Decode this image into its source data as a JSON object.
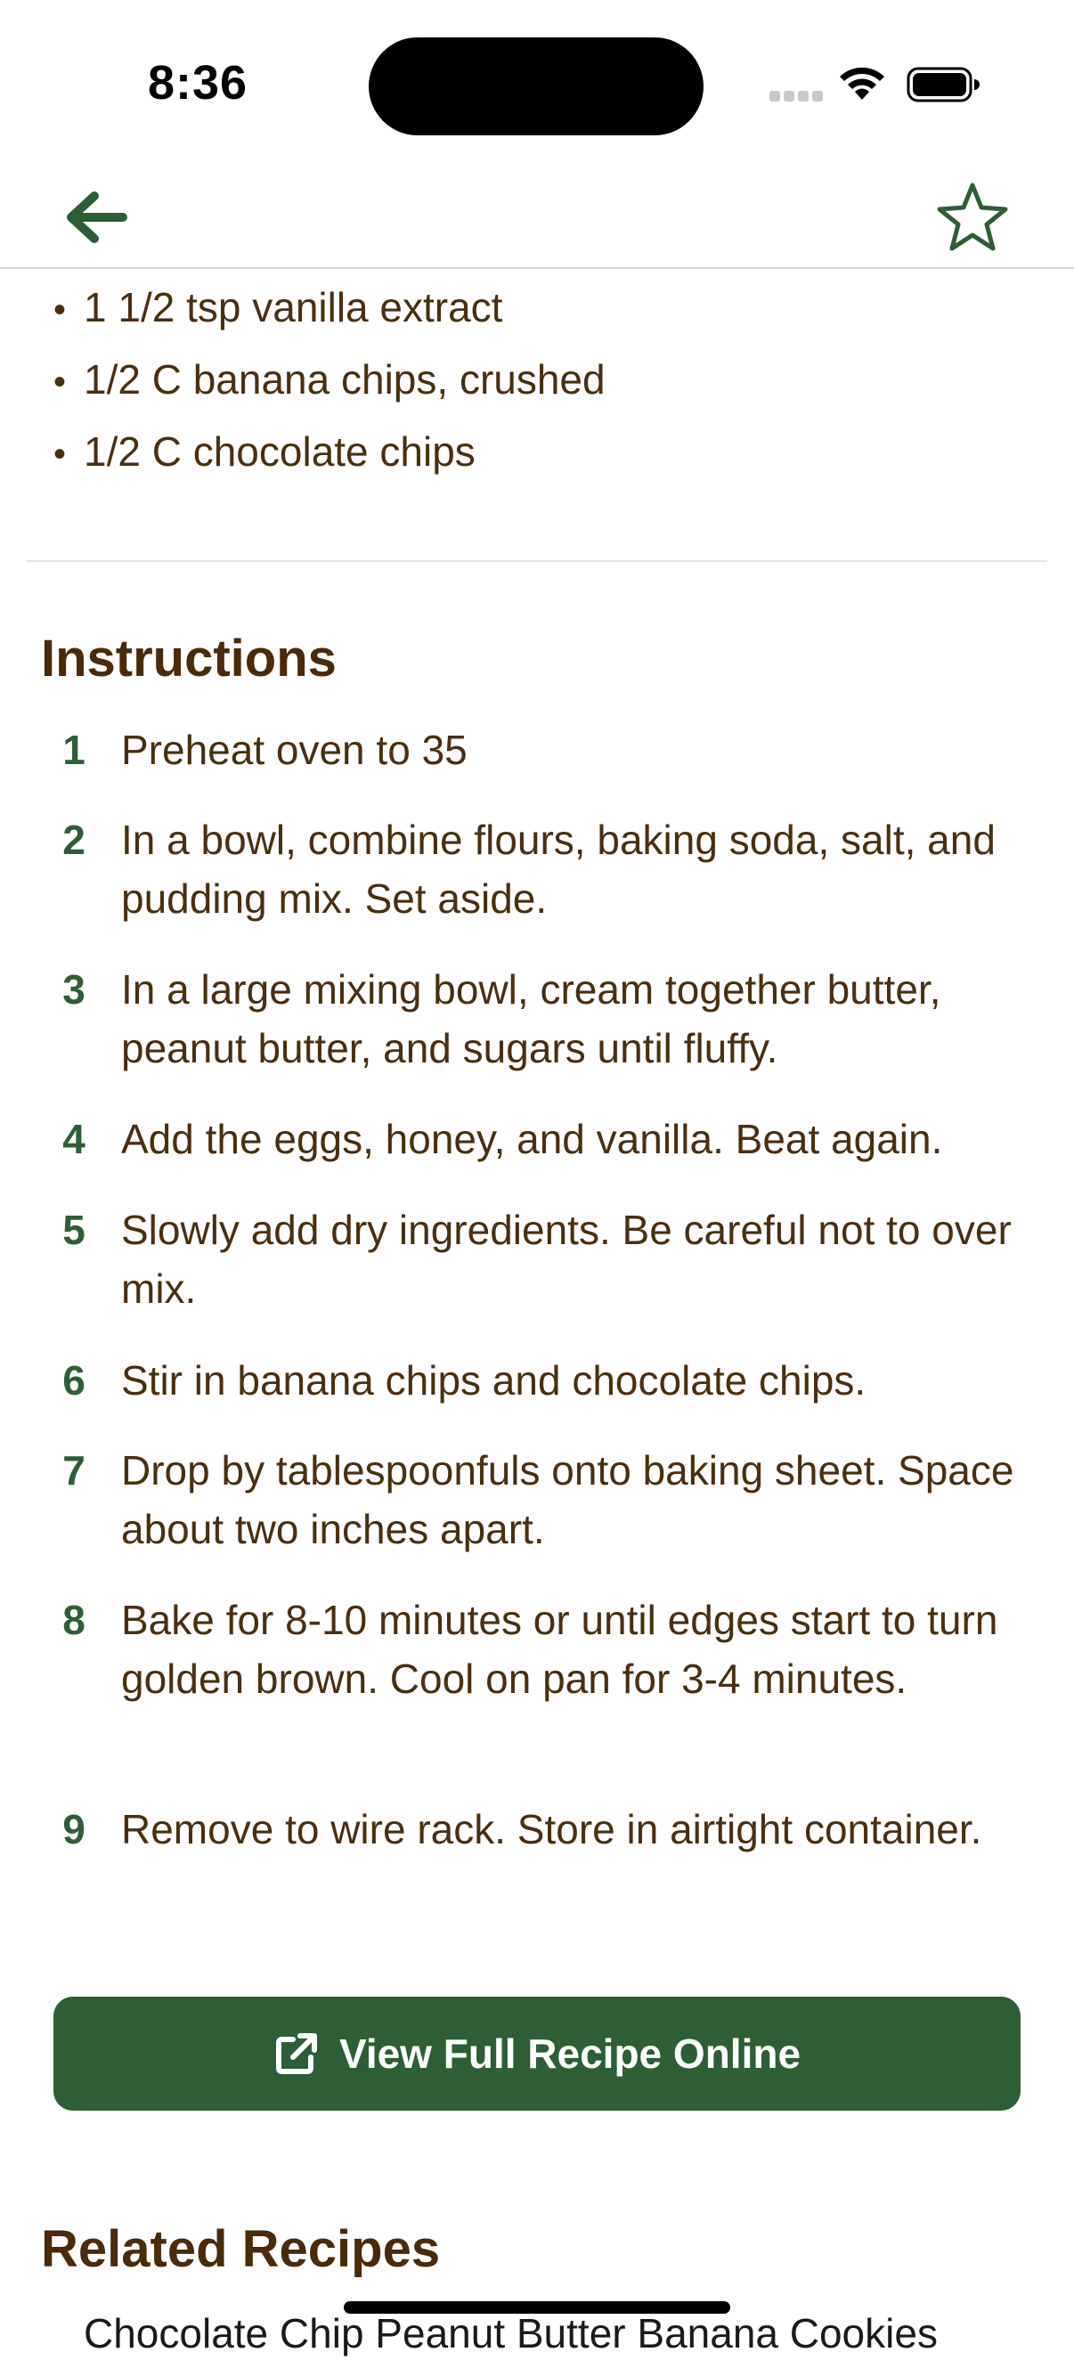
{
  "status_bar": {
    "time": "8:36"
  },
  "nav": {
    "back_icon": "arrow-left-icon",
    "favorite_icon": "star-outline-icon",
    "accent_color": "#2d5e35"
  },
  "ingredients": [
    "1 1/2 tsp vanilla extract",
    "1/2 C banana chips, crushed",
    "1/2 C chocolate chips"
  ],
  "instructions": {
    "title": "Instructions",
    "steps": [
      {
        "number": "1",
        "text": "Preheat oven to 35"
      },
      {
        "number": "2",
        "text": "In a bowl, combine flours, baking soda, salt, and pudding mix. Set aside."
      },
      {
        "number": "3",
        "text": "In a large mixing bowl, cream together butter, peanut butter, and sugars until fluffy."
      },
      {
        "number": "4",
        "text": "Add the eggs, honey, and vanilla. Beat again."
      },
      {
        "number": "5",
        "text": "Slowly add dry ingredients. Be careful not to over mix."
      },
      {
        "number": "6",
        "text": "Stir in banana chips and chocolate chips."
      },
      {
        "number": "7",
        "text": "Drop by tablespoonfuls onto baking sheet. Space about two inches apart."
      },
      {
        "number": "8",
        "text": "Bake for 8-10 minutes or until edges start to turn golden brown. Cool on pan for 3-4 minutes."
      },
      {
        "number": "9",
        "text": "Remove to wire rack. Store in airtight container."
      }
    ]
  },
  "view_online": {
    "label": "View Full Recipe Online",
    "icon": "external-link-icon"
  },
  "related": {
    "title": "Related Recipes",
    "items": [
      "Chocolate Chip Peanut Butter Banana Cookies"
    ]
  }
}
